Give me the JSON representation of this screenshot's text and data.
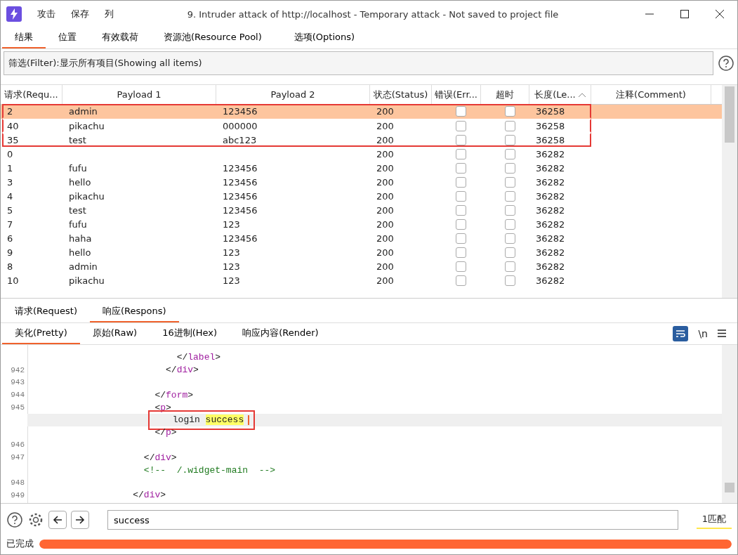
{
  "window": {
    "title": "9. Intruder attack of http://localhost - Temporary attack - Not saved to project file",
    "menu": [
      "攻击",
      "保存",
      "列"
    ]
  },
  "tabs": [
    {
      "label": "结果",
      "selected": true
    },
    {
      "label": "位置",
      "selected": false
    },
    {
      "label": "有效载荷",
      "selected": false
    },
    {
      "label": "资源池(Resource Pool)",
      "selected": false
    },
    {
      "label": "选项(Options)",
      "selected": false
    }
  ],
  "filter": {
    "text": "筛选(Filter):显示所有项目(Showing all items)"
  },
  "table": {
    "columns": [
      {
        "label": "请求(Requ...",
        "sorted": false
      },
      {
        "label": "Payload 1",
        "sorted": false
      },
      {
        "label": "Payload 2",
        "sorted": false
      },
      {
        "label": "状态(Status)",
        "sorted": false
      },
      {
        "label": "错误(Err...",
        "sorted": false
      },
      {
        "label": "超时",
        "sorted": false
      },
      {
        "label": "长度(Le...",
        "sorted": true
      },
      {
        "label": "注释(Comment)",
        "sorted": false
      }
    ],
    "rows": [
      {
        "request": "2",
        "payload1": "admin",
        "payload2": "123456",
        "status": "200",
        "error": false,
        "timeout": false,
        "length": "36258",
        "selected": true,
        "boxed": true
      },
      {
        "request": "40",
        "payload1": "pikachu",
        "payload2": "000000",
        "status": "200",
        "error": false,
        "timeout": false,
        "length": "36258",
        "selected": false,
        "boxed": true
      },
      {
        "request": "35",
        "payload1": "test",
        "payload2": "abc123",
        "status": "200",
        "error": false,
        "timeout": false,
        "length": "36258",
        "selected": false,
        "boxed": true
      },
      {
        "request": "0",
        "status": "200",
        "error": false,
        "timeout": false,
        "length": "36282",
        "selected": false,
        "boxed": false
      },
      {
        "request": "1",
        "payload1": "fufu",
        "payload2": "123456",
        "status": "200",
        "error": false,
        "timeout": false,
        "length": "36282",
        "selected": false,
        "boxed": false
      },
      {
        "request": "3",
        "payload1": "hello",
        "payload2": "123456",
        "status": "200",
        "error": false,
        "timeout": false,
        "length": "36282",
        "selected": false,
        "boxed": false
      },
      {
        "request": "4",
        "payload1": "pikachu",
        "payload2": "123456",
        "status": "200",
        "error": false,
        "timeout": false,
        "length": "36282",
        "selected": false,
        "boxed": false
      },
      {
        "request": "5",
        "payload1": "test",
        "payload2": "123456",
        "status": "200",
        "error": false,
        "timeout": false,
        "length": "36282",
        "selected": false,
        "boxed": false
      },
      {
        "request": "7",
        "payload1": "fufu",
        "payload2": "123",
        "status": "200",
        "error": false,
        "timeout": false,
        "length": "36282",
        "selected": false,
        "boxed": false
      },
      {
        "request": "6",
        "payload1": "haha",
        "payload2": "123456",
        "status": "200",
        "error": false,
        "timeout": false,
        "length": "36282",
        "selected": false,
        "boxed": false
      },
      {
        "request": "9",
        "payload1": "hello",
        "payload2": "123",
        "status": "200",
        "error": false,
        "timeout": false,
        "length": "36282",
        "selected": false,
        "boxed": false
      },
      {
        "request": "8",
        "payload1": "admin",
        "payload2": "123",
        "status": "200",
        "error": false,
        "timeout": false,
        "length": "36282",
        "selected": false,
        "boxed": false
      },
      {
        "request": "10",
        "payload1": "pikachu",
        "payload2": "123",
        "status": "200",
        "error": false,
        "timeout": false,
        "length": "36282",
        "selected": false,
        "boxed": false
      }
    ]
  },
  "message_tabs": [
    {
      "label": "请求(Request)",
      "selected": false
    },
    {
      "label": "响应(Respons)",
      "selected": true
    }
  ],
  "view_tabs": [
    {
      "label": "美化(Pretty)",
      "selected": true
    },
    {
      "label": "原始(Raw)",
      "selected": false
    },
    {
      "label": "16进制(Hex)",
      "selected": false
    },
    {
      "label": "响应内容(Render)",
      "selected": false
    }
  ],
  "view_tools": {
    "newline": "\\n"
  },
  "code": [
    {
      "tokens": [
        {
          "kind": "punct",
          "text": "                           </"
        },
        {
          "kind": "tag",
          "text": "label"
        },
        {
          "kind": "punct",
          "text": ">"
        }
      ]
    },
    {
      "number": "942",
      "tokens": [
        {
          "kind": "punct",
          "text": "                         </"
        },
        {
          "kind": "tag",
          "text": "div"
        },
        {
          "kind": "punct",
          "text": ">"
        }
      ]
    },
    {
      "number": "943"
    },
    {
      "number": "944",
      "tokens": [
        {
          "kind": "punct",
          "text": "                       </"
        },
        {
          "kind": "tag",
          "text": "form"
        },
        {
          "kind": "punct",
          "text": ">"
        }
      ]
    },
    {
      "number": "945",
      "tokens": [
        {
          "kind": "punct",
          "text": "                       <"
        },
        {
          "kind": "tag",
          "text": "p"
        },
        {
          "kind": "punct",
          "text": ">"
        }
      ]
    },
    {
      "current": true,
      "boxed": true,
      "tokens": [
        {
          "kind": "plain",
          "text": "                          login "
        },
        {
          "kind": "match",
          "text": "success"
        }
      ]
    },
    {
      "tokens": [
        {
          "kind": "punct",
          "text": "                       </"
        },
        {
          "kind": "tag",
          "text": "p"
        },
        {
          "kind": "punct",
          "text": ">"
        }
      ]
    },
    {
      "number": "946"
    },
    {
      "number": "947",
      "tokens": [
        {
          "kind": "punct",
          "text": "                     </"
        },
        {
          "kind": "tag",
          "text": "div"
        },
        {
          "kind": "punct",
          "text": ">"
        }
      ]
    },
    {
      "tokens": [
        {
          "kind": "comment",
          "text": "                     <!--  /.widget-main  -->"
        }
      ]
    },
    {
      "number": "948"
    },
    {
      "number": "949",
      "tokens": [
        {
          "kind": "punct",
          "text": "                   </"
        },
        {
          "kind": "tag",
          "text": "div"
        },
        {
          "kind": "punct",
          "text": ">"
        }
      ]
    }
  ],
  "search": {
    "value": "success",
    "matches": "1匹配"
  },
  "status": {
    "text": "已完成",
    "level": 1
  }
}
